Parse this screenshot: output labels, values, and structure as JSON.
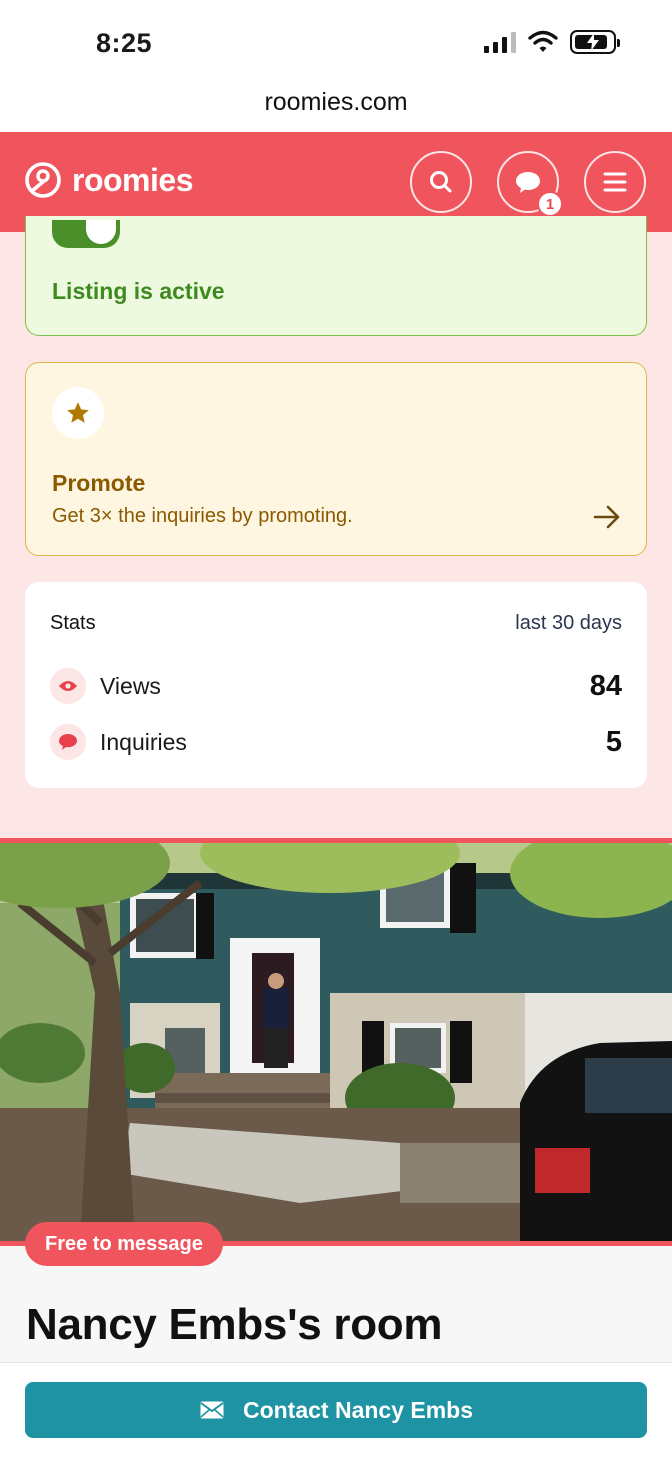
{
  "status_bar": {
    "time": "8:25"
  },
  "browser": {
    "url": "roomies.com"
  },
  "header": {
    "logo_text": "roomies",
    "messages_badge": "1",
    "brand_color": "#f0555e"
  },
  "listing_status": {
    "label": "Listing is active",
    "toggle_on": true
  },
  "promote": {
    "title": "Promote",
    "subtitle": "Get 3× the inquiries by promoting."
  },
  "stats": {
    "title": "Stats",
    "period": "last 30 days",
    "rows": [
      {
        "label": "Views",
        "value": "84",
        "icon": "eye-icon"
      },
      {
        "label": "Inquiries",
        "value": "5",
        "icon": "chat-bubble-icon"
      }
    ]
  },
  "room": {
    "badge": "Free to message",
    "title": "Nancy Embs's room"
  },
  "contact": {
    "button_label": "Contact Nancy Embs",
    "button_color": "#1d93a3"
  }
}
